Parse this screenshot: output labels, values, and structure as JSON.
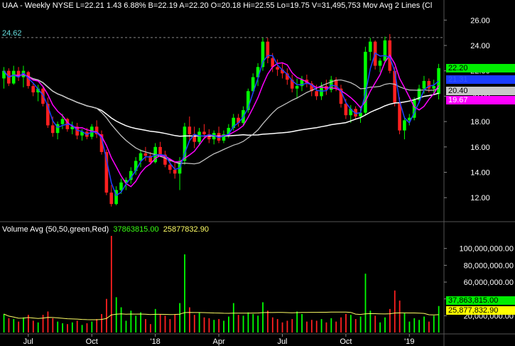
{
  "header": {
    "text": "UAA - Weekly  NYSE  L=22.21  1.43  6.88%  B=22.19  A=22.20  O=20.18  Hi=22.55  Lo=19.75  V=31,495,753  Mov Avg 2 Lines (Cl"
  },
  "resistance_label": "24.62",
  "volume_header": {
    "title": "Volume Avg (50,50,green,Red)",
    "v1": "37863815.00",
    "v2": "25877832.90"
  },
  "price_tags": [
    {
      "label": "22.20",
      "value": 22.2,
      "bg": "#00ee00",
      "fg": "#000000"
    },
    {
      "label": "21.31",
      "value": 21.31,
      "bg": "#1a3cff",
      "fg": "#3355ff"
    },
    {
      "label": "20.40",
      "value": 20.4,
      "bg": "#c8c8c8",
      "fg": "#000000"
    },
    {
      "label": "19.67",
      "value": 19.67,
      "bg": "#ff00ff",
      "fg": "#ffffff"
    }
  ],
  "volume_tags": [
    {
      "label": "37,863,815.00",
      "value": 37863815,
      "bg": "#00ee00",
      "fg": "#000000"
    },
    {
      "label": "25,877,832.90",
      "value": 25877832.9,
      "bg": "#ffff00",
      "fg": "#000000"
    }
  ],
  "colors": {
    "up": "#00ff00",
    "down": "#ff2020",
    "ma_fast": "#2040ff",
    "ma_mid": "#ff00ff",
    "ma_slow_grey": "#bfbfbf",
    "ma_long_white": "#ffffff",
    "vol_avg": "#ffff66",
    "resistance": "#888888",
    "axis_text": "#ffffff",
    "label_cyan": "#66dddd"
  },
  "chart_data": {
    "type": "candlestick",
    "price_axis": {
      "ticks": [
        "26.00",
        "24.00",
        "22.00",
        "20.00",
        "18.00",
        "16.00",
        "14.00",
        "12.00"
      ],
      "range": [
        10.5,
        26.8
      ]
    },
    "volume_axis": {
      "ticks": [
        "100,000,000.00",
        "80,000,000.00",
        "60,000,000.00",
        "40,000,000.00",
        "20,000,000.00"
      ],
      "range": [
        0,
        115000000
      ]
    },
    "x_labels": [
      "Jul",
      "Oct",
      "'18",
      "Apr",
      "Jul",
      "Oct",
      "'19"
    ],
    "resistance": 24.62,
    "candles": [
      {
        "d": "2017-06-02",
        "o": 21.4,
        "h": 22.3,
        "l": 20.6,
        "c": 22.0,
        "v": 22000000
      },
      {
        "d": "2017-06-09",
        "o": 22.0,
        "h": 22.2,
        "l": 20.8,
        "c": 21.0,
        "v": 17000000
      },
      {
        "d": "2017-06-16",
        "o": 21.0,
        "h": 22.4,
        "l": 20.9,
        "c": 22.0,
        "v": 16000000
      },
      {
        "d": "2017-06-23",
        "o": 22.0,
        "h": 22.3,
        "l": 21.2,
        "c": 21.5,
        "v": 13000000
      },
      {
        "d": "2017-06-30",
        "o": 21.5,
        "h": 22.4,
        "l": 20.7,
        "c": 22.0,
        "v": 18000000
      },
      {
        "d": "2017-07-07",
        "o": 21.9,
        "h": 22.0,
        "l": 20.6,
        "c": 20.8,
        "v": 21000000
      },
      {
        "d": "2017-07-14",
        "o": 20.8,
        "h": 21.0,
        "l": 20.0,
        "c": 20.3,
        "v": 14000000
      },
      {
        "d": "2017-07-21",
        "o": 20.3,
        "h": 20.9,
        "l": 19.6,
        "c": 20.6,
        "v": 12000000
      },
      {
        "d": "2017-07-28",
        "o": 20.6,
        "h": 20.8,
        "l": 19.2,
        "c": 19.4,
        "v": 21000000
      },
      {
        "d": "2017-08-04",
        "o": 19.4,
        "h": 19.9,
        "l": 17.5,
        "c": 17.7,
        "v": 25000000
      },
      {
        "d": "2017-08-11",
        "o": 17.7,
        "h": 18.4,
        "l": 16.8,
        "c": 17.1,
        "v": 17000000
      },
      {
        "d": "2017-08-18",
        "o": 17.1,
        "h": 18.0,
        "l": 16.6,
        "c": 17.8,
        "v": 13000000
      },
      {
        "d": "2017-08-25",
        "o": 17.8,
        "h": 18.6,
        "l": 17.4,
        "c": 18.2,
        "v": 11000000
      },
      {
        "d": "2017-09-01",
        "o": 18.2,
        "h": 18.3,
        "l": 17.2,
        "c": 17.4,
        "v": 10000000
      },
      {
        "d": "2017-09-08",
        "o": 17.4,
        "h": 18.0,
        "l": 17.0,
        "c": 17.6,
        "v": 12000000
      },
      {
        "d": "2017-09-15",
        "o": 17.6,
        "h": 17.9,
        "l": 16.6,
        "c": 16.9,
        "v": 14000000
      },
      {
        "d": "2017-09-22",
        "o": 16.9,
        "h": 17.4,
        "l": 16.5,
        "c": 17.2,
        "v": 9000000
      },
      {
        "d": "2017-09-29",
        "o": 17.2,
        "h": 17.5,
        "l": 16.6,
        "c": 16.8,
        "v": 11000000
      },
      {
        "d": "2017-10-06",
        "o": 16.8,
        "h": 17.8,
        "l": 16.6,
        "c": 17.6,
        "v": 13000000
      },
      {
        "d": "2017-10-13",
        "o": 17.6,
        "h": 18.1,
        "l": 16.7,
        "c": 17.0,
        "v": 16000000
      },
      {
        "d": "2017-10-20",
        "o": 17.0,
        "h": 17.3,
        "l": 15.4,
        "c": 15.6,
        "v": 22000000
      },
      {
        "d": "2017-10-27",
        "o": 15.6,
        "h": 15.8,
        "l": 12.2,
        "c": 12.4,
        "v": 40000000
      },
      {
        "d": "2017-11-03",
        "o": 12.4,
        "h": 13.0,
        "l": 11.3,
        "c": 11.5,
        "v": 115000000
      },
      {
        "d": "2017-11-10",
        "o": 11.5,
        "h": 12.9,
        "l": 11.4,
        "c": 12.6,
        "v": 42000000
      },
      {
        "d": "2017-11-17",
        "o": 12.6,
        "h": 13.5,
        "l": 12.3,
        "c": 13.2,
        "v": 30000000
      },
      {
        "d": "2017-11-24",
        "o": 13.2,
        "h": 13.6,
        "l": 12.6,
        "c": 13.4,
        "v": 14000000
      },
      {
        "d": "2017-12-01",
        "o": 13.4,
        "h": 14.4,
        "l": 13.1,
        "c": 14.1,
        "v": 26000000
      },
      {
        "d": "2017-12-08",
        "o": 14.1,
        "h": 15.2,
        "l": 13.8,
        "c": 14.9,
        "v": 20000000
      },
      {
        "d": "2017-12-15",
        "o": 14.9,
        "h": 15.8,
        "l": 14.4,
        "c": 15.5,
        "v": 24000000
      },
      {
        "d": "2017-12-22",
        "o": 15.5,
        "h": 16.0,
        "l": 14.9,
        "c": 15.3,
        "v": 16000000
      },
      {
        "d": "2017-12-29",
        "o": 15.3,
        "h": 15.6,
        "l": 14.6,
        "c": 14.8,
        "v": 10000000
      },
      {
        "d": "2018-01-05",
        "o": 14.8,
        "h": 16.3,
        "l": 14.7,
        "c": 16.0,
        "v": 28000000
      },
      {
        "d": "2018-01-12",
        "o": 16.0,
        "h": 16.4,
        "l": 15.2,
        "c": 15.4,
        "v": 22000000
      },
      {
        "d": "2018-01-19",
        "o": 15.4,
        "h": 15.7,
        "l": 14.4,
        "c": 14.6,
        "v": 20000000
      },
      {
        "d": "2018-01-26",
        "o": 14.6,
        "h": 15.0,
        "l": 13.9,
        "c": 14.2,
        "v": 16000000
      },
      {
        "d": "2018-02-02",
        "o": 14.2,
        "h": 14.8,
        "l": 13.5,
        "c": 13.9,
        "v": 22000000
      },
      {
        "d": "2018-02-09",
        "o": 13.9,
        "h": 15.2,
        "l": 12.6,
        "c": 14.9,
        "v": 35000000
      },
      {
        "d": "2018-02-16",
        "o": 14.9,
        "h": 17.9,
        "l": 14.6,
        "c": 17.6,
        "v": 93000000
      },
      {
        "d": "2018-02-23",
        "o": 17.6,
        "h": 18.4,
        "l": 16.5,
        "c": 17.0,
        "v": 30000000
      },
      {
        "d": "2018-03-02",
        "o": 17.0,
        "h": 17.6,
        "l": 15.9,
        "c": 16.4,
        "v": 21000000
      },
      {
        "d": "2018-03-09",
        "o": 16.4,
        "h": 17.5,
        "l": 16.1,
        "c": 17.2,
        "v": 24000000
      },
      {
        "d": "2018-03-16",
        "o": 17.2,
        "h": 17.8,
        "l": 16.6,
        "c": 17.0,
        "v": 18000000
      },
      {
        "d": "2018-03-23",
        "o": 17.0,
        "h": 17.4,
        "l": 16.3,
        "c": 16.6,
        "v": 17000000
      },
      {
        "d": "2018-03-30",
        "o": 16.6,
        "h": 17.3,
        "l": 16.2,
        "c": 17.1,
        "v": 15000000
      },
      {
        "d": "2018-04-06",
        "o": 17.1,
        "h": 17.6,
        "l": 16.3,
        "c": 16.5,
        "v": 16000000
      },
      {
        "d": "2018-04-13",
        "o": 16.5,
        "h": 17.3,
        "l": 16.3,
        "c": 17.0,
        "v": 14000000
      },
      {
        "d": "2018-04-20",
        "o": 17.0,
        "h": 17.8,
        "l": 16.7,
        "c": 17.5,
        "v": 19000000
      },
      {
        "d": "2018-04-27",
        "o": 17.5,
        "h": 18.6,
        "l": 17.3,
        "c": 18.3,
        "v": 35000000
      },
      {
        "d": "2018-05-04",
        "o": 18.3,
        "h": 18.6,
        "l": 17.6,
        "c": 17.9,
        "v": 21000000
      },
      {
        "d": "2018-05-11",
        "o": 17.9,
        "h": 19.2,
        "l": 17.7,
        "c": 18.9,
        "v": 20000000
      },
      {
        "d": "2018-05-18",
        "o": 18.9,
        "h": 20.6,
        "l": 18.7,
        "c": 20.4,
        "v": 24000000
      },
      {
        "d": "2018-05-25",
        "o": 20.4,
        "h": 21.8,
        "l": 20.2,
        "c": 21.5,
        "v": 22000000
      },
      {
        "d": "2018-06-01",
        "o": 21.5,
        "h": 22.6,
        "l": 20.8,
        "c": 22.3,
        "v": 20000000
      },
      {
        "d": "2018-06-08",
        "o": 22.3,
        "h": 24.6,
        "l": 22.0,
        "c": 24.3,
        "v": 36000000
      },
      {
        "d": "2018-06-15",
        "o": 24.3,
        "h": 24.6,
        "l": 22.6,
        "c": 23.0,
        "v": 26000000
      },
      {
        "d": "2018-06-22",
        "o": 23.0,
        "h": 23.4,
        "l": 21.9,
        "c": 22.3,
        "v": 18000000
      },
      {
        "d": "2018-06-29",
        "o": 22.3,
        "h": 22.9,
        "l": 21.6,
        "c": 22.1,
        "v": 16000000
      },
      {
        "d": "2018-07-06",
        "o": 22.1,
        "h": 22.6,
        "l": 21.4,
        "c": 21.8,
        "v": 12000000
      },
      {
        "d": "2018-07-13",
        "o": 21.8,
        "h": 22.2,
        "l": 20.9,
        "c": 21.3,
        "v": 14000000
      },
      {
        "d": "2018-07-20",
        "o": 21.3,
        "h": 21.7,
        "l": 20.3,
        "c": 20.6,
        "v": 16000000
      },
      {
        "d": "2018-07-27",
        "o": 20.6,
        "h": 21.4,
        "l": 19.8,
        "c": 20.8,
        "v": 25000000
      },
      {
        "d": "2018-08-03",
        "o": 20.8,
        "h": 21.6,
        "l": 20.4,
        "c": 21.3,
        "v": 22000000
      },
      {
        "d": "2018-08-10",
        "o": 21.3,
        "h": 21.7,
        "l": 20.7,
        "c": 21.0,
        "v": 13000000
      },
      {
        "d": "2018-08-17",
        "o": 21.0,
        "h": 21.2,
        "l": 20.0,
        "c": 20.4,
        "v": 15000000
      },
      {
        "d": "2018-08-24",
        "o": 20.4,
        "h": 20.9,
        "l": 19.7,
        "c": 20.0,
        "v": 14000000
      },
      {
        "d": "2018-08-31",
        "o": 20.0,
        "h": 21.1,
        "l": 19.7,
        "c": 20.8,
        "v": 16000000
      },
      {
        "d": "2018-09-07",
        "o": 20.8,
        "h": 21.3,
        "l": 20.1,
        "c": 20.5,
        "v": 12000000
      },
      {
        "d": "2018-09-14",
        "o": 20.5,
        "h": 21.6,
        "l": 20.3,
        "c": 21.3,
        "v": 17000000
      },
      {
        "d": "2018-09-21",
        "o": 21.3,
        "h": 21.5,
        "l": 20.4,
        "c": 20.6,
        "v": 13000000
      },
      {
        "d": "2018-09-28",
        "o": 20.6,
        "h": 20.9,
        "l": 19.1,
        "c": 19.4,
        "v": 18000000
      },
      {
        "d": "2018-10-05",
        "o": 19.4,
        "h": 19.8,
        "l": 18.2,
        "c": 18.5,
        "v": 22000000
      },
      {
        "d": "2018-10-12",
        "o": 18.5,
        "h": 19.3,
        "l": 17.9,
        "c": 19.0,
        "v": 21000000
      },
      {
        "d": "2018-10-19",
        "o": 19.0,
        "h": 19.2,
        "l": 18.2,
        "c": 18.4,
        "v": 16000000
      },
      {
        "d": "2018-10-26",
        "o": 18.4,
        "h": 19.1,
        "l": 17.9,
        "c": 18.7,
        "v": 19000000
      },
      {
        "d": "2018-11-02",
        "o": 18.7,
        "h": 23.9,
        "l": 18.5,
        "c": 23.5,
        "v": 70000000
      },
      {
        "d": "2018-11-09",
        "o": 23.5,
        "h": 24.6,
        "l": 22.8,
        "c": 24.3,
        "v": 26000000
      },
      {
        "d": "2018-11-16",
        "o": 24.3,
        "h": 24.4,
        "l": 22.1,
        "c": 22.4,
        "v": 20000000
      },
      {
        "d": "2018-11-23",
        "o": 22.4,
        "h": 23.0,
        "l": 21.9,
        "c": 22.8,
        "v": 12000000
      },
      {
        "d": "2018-11-30",
        "o": 22.8,
        "h": 24.7,
        "l": 22.6,
        "c": 24.4,
        "v": 18000000
      },
      {
        "d": "2018-12-07",
        "o": 24.4,
        "h": 24.9,
        "l": 21.8,
        "c": 22.0,
        "v": 28000000
      },
      {
        "d": "2018-12-14",
        "o": 22.0,
        "h": 22.3,
        "l": 19.2,
        "c": 19.5,
        "v": 50000000
      },
      {
        "d": "2018-12-21",
        "o": 19.5,
        "h": 19.9,
        "l": 17.0,
        "c": 17.3,
        "v": 38000000
      },
      {
        "d": "2018-12-28",
        "o": 17.3,
        "h": 18.4,
        "l": 16.6,
        "c": 18.1,
        "v": 23000000
      },
      {
        "d": "2019-01-04",
        "o": 18.1,
        "h": 18.6,
        "l": 17.7,
        "c": 18.3,
        "v": 13000000
      },
      {
        "d": "2019-01-11",
        "o": 18.3,
        "h": 19.9,
        "l": 18.1,
        "c": 19.7,
        "v": 17000000
      },
      {
        "d": "2019-01-18",
        "o": 19.7,
        "h": 20.9,
        "l": 19.5,
        "c": 20.6,
        "v": 15000000
      },
      {
        "d": "2019-01-25",
        "o": 20.6,
        "h": 21.6,
        "l": 20.2,
        "c": 21.2,
        "v": 19000000
      },
      {
        "d": "2019-02-01",
        "o": 21.2,
        "h": 21.4,
        "l": 20.3,
        "c": 20.6,
        "v": 13000000
      },
      {
        "d": "2019-02-08",
        "o": 20.6,
        "h": 21.3,
        "l": 20.1,
        "c": 20.8,
        "v": 20000000
      },
      {
        "d": "2019-02-15",
        "o": 20.18,
        "h": 22.55,
        "l": 19.75,
        "c": 22.21,
        "v": 31495753
      }
    ]
  }
}
